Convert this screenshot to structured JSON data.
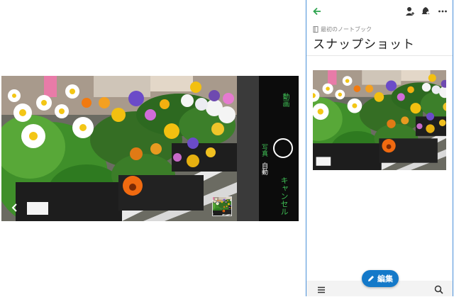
{
  "camera": {
    "mode_video": "動画",
    "mode_photo": "写真",
    "flash_auto": "自動",
    "cancel": "キャンセル"
  },
  "note": {
    "breadcrumb": "最初のノートブック",
    "title": "スナップショット",
    "edit_label": "編集"
  },
  "colors": {
    "accent_green": "#3fbf55",
    "edit_blue": "#1479c9",
    "frame_blue": "#4a90d9"
  },
  "icons": {
    "back": "arrow-left-icon",
    "add_person": "add-person-icon",
    "notify": "bell-plus-icon",
    "more": "more-horizontal-icon",
    "menu": "hamburger-icon",
    "search": "search-icon",
    "pencil": "pencil-icon",
    "notebook": "notebook-icon"
  }
}
